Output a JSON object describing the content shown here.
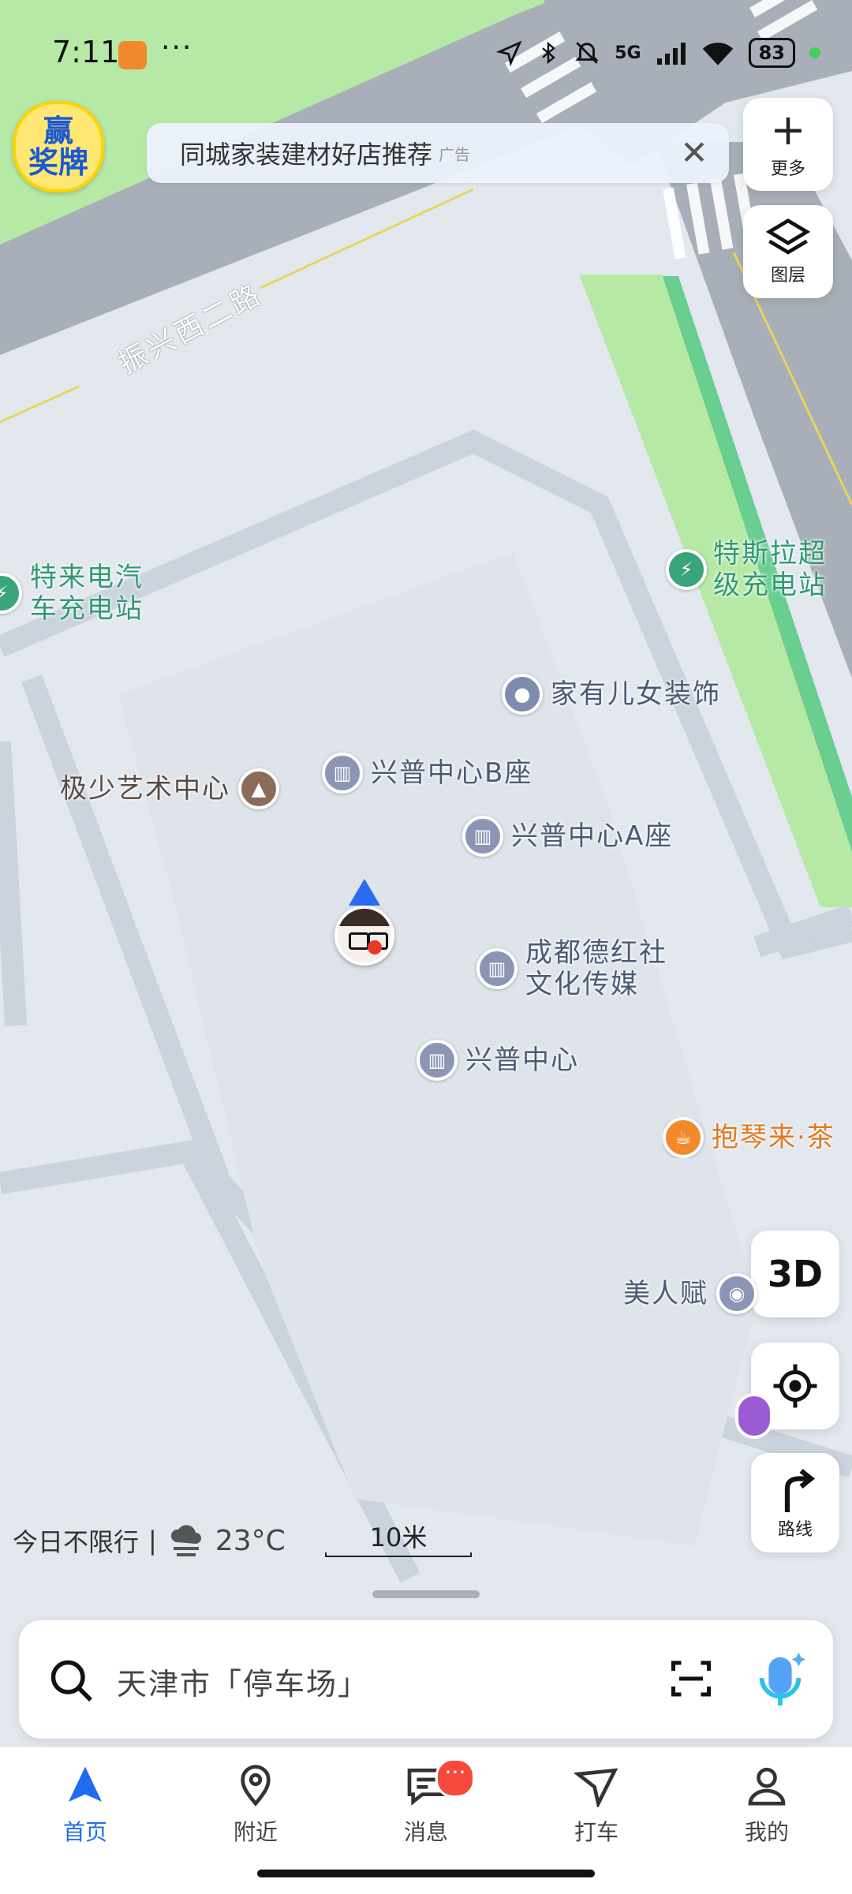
{
  "status_bar": {
    "time": "7:11",
    "dots": "···",
    "network": "5G",
    "battery": "83"
  },
  "ad_banner": {
    "text": "同城家装建材好店推荐",
    "tag": "广告",
    "close": "✕"
  },
  "award_badge": {
    "line1": "赢",
    "line2": "奖牌"
  },
  "side_buttons": {
    "more": "更多",
    "layers": "图层",
    "three_d": "3D",
    "route": "路线"
  },
  "road_label": "振兴西二路",
  "pois": {
    "tesla": {
      "line1": "特斯拉超",
      "line2": "级充电站"
    },
    "telai": {
      "line1": "特来电汽",
      "line2": "车充电站"
    },
    "jiayou": "家有儿女装饰",
    "jishao": "极少艺术中心",
    "xingpu_b": "兴普中心B座",
    "xingpu_a": "兴普中心A座",
    "chengdu": {
      "line1": "成都德红社",
      "line2": "文化传媒"
    },
    "xingpu": "兴普中心",
    "baoqin": "抱琴来·茶",
    "meirenfu": "美人赋"
  },
  "info_bar": {
    "restriction": "今日不限行",
    "divider": "|",
    "temperature": "23°C",
    "scale": "10米"
  },
  "search": {
    "placeholder": "天津市「停车场」"
  },
  "tabs": [
    {
      "label": "首页"
    },
    {
      "label": "附近"
    },
    {
      "label": "消息",
      "badge": "···"
    },
    {
      "label": "打车"
    },
    {
      "label": "我的"
    }
  ],
  "colors": {
    "accent": "#1f6cf0",
    "green_area": "#b6e9a6",
    "road": "#a9afb8"
  }
}
